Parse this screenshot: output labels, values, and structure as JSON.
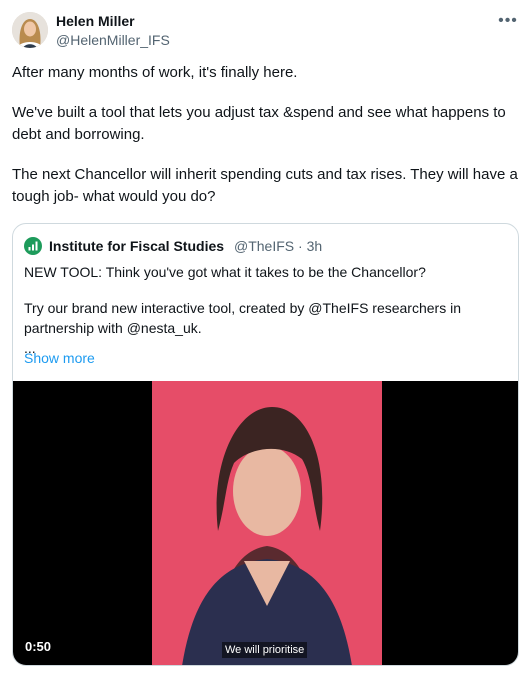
{
  "author": {
    "name": "Helen Miller",
    "handle": "@HelenMiller_IFS"
  },
  "post": {
    "paragraphs": [
      "After many months of work, it's finally here.",
      "We've built a tool that lets you adjust tax &spend and see what happens to debt and borrowing.",
      "The next Chancellor will inherit spending cuts and tax rises. They will have a tough job- what would you do?"
    ]
  },
  "quote": {
    "org_name": "Institute for Fiscal Studies",
    "org_handle": "@TheIFS",
    "separator": "·",
    "time": "3h",
    "text": [
      "NEW TOOL: Think you've got what it takes to be the Chancellor?",
      "Try our brand new interactive tool, created by @TheIFS researchers in partnership with @nesta_uk."
    ],
    "ellipsis": "...",
    "show_more": "Show more"
  },
  "video": {
    "duration": "0:50",
    "caption": "We will prioritise"
  },
  "colors": {
    "link": "#1d9bf0",
    "muted": "#536471",
    "border": "#cfd9de",
    "video_bg": "#e64d68"
  },
  "icons": {
    "more": "more-horizontal-icon",
    "org": "ifs-logo-icon"
  }
}
